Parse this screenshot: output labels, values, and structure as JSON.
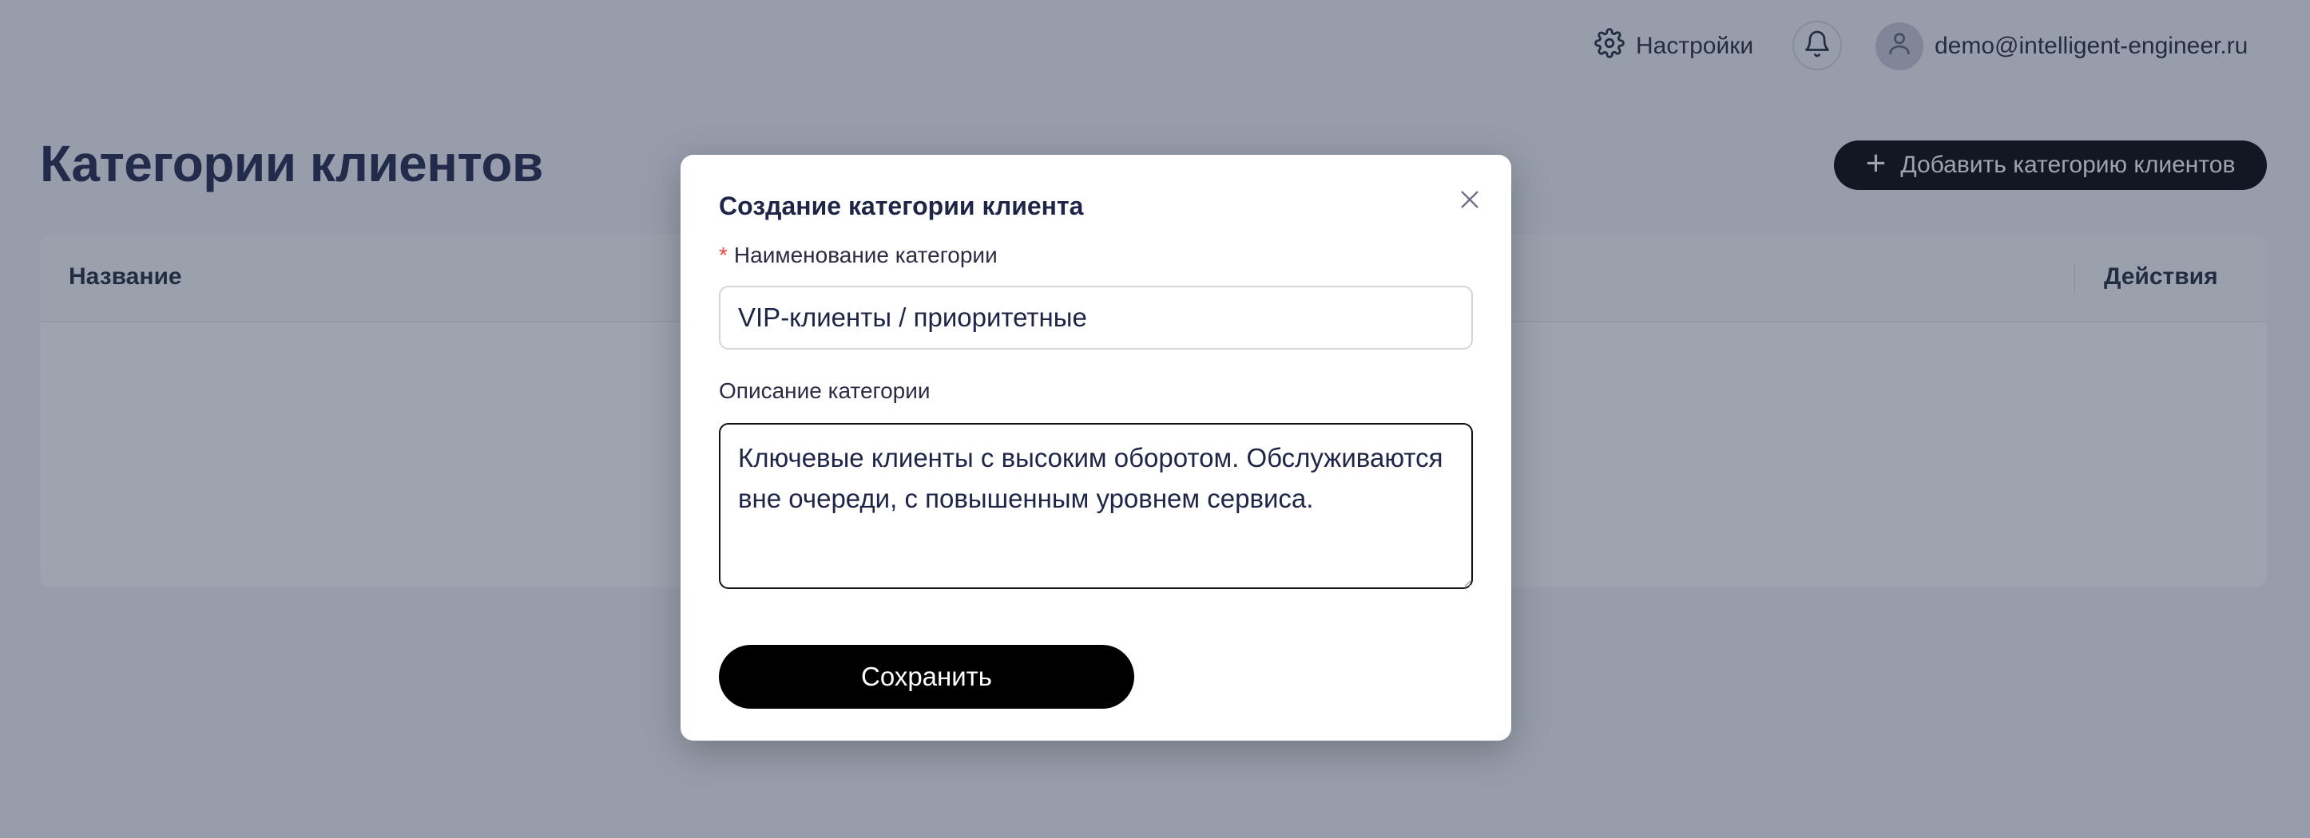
{
  "header": {
    "settings_label": "Настройки",
    "user_email": "demo@intelligent-engineer.ru"
  },
  "page": {
    "title": "Категории клиентов",
    "add_button_label": "Добавить категорию клиентов"
  },
  "table": {
    "columns": [
      "Название",
      "Действия"
    ]
  },
  "modal": {
    "title": "Создание категории клиента",
    "name_label": "Наименование категории",
    "name_required_mark": "*",
    "name_value": "VIP-клиенты / приоритетные",
    "description_label": "Описание категории",
    "description_value": "Ключевые клиенты с высоким оборотом. Обслуживаются вне очереди, с повышенным уровнем сервиса.",
    "save_label": "Сохранить"
  },
  "icons": {
    "settings": "gear-icon",
    "notifications": "bell-icon",
    "avatar": "user-icon",
    "add": "plus-icon",
    "close": "close-icon"
  }
}
